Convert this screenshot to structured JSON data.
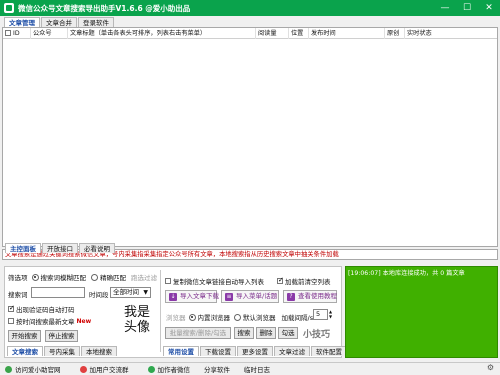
{
  "title": "微信公众号文章搜索导出助手V1.6.6  @爱小助出品",
  "window_controls": {
    "minimize": "—",
    "maximize": "☐",
    "close": "✕"
  },
  "top_tabs": [
    "文章管理",
    "文章合并",
    "登录软件"
  ],
  "columns": [
    "ID",
    "公众号",
    "文章标题（单击各表头可排序，列表右击有菜单）",
    "阅读量",
    "位置",
    "发布时间",
    "原创",
    "实时状态"
  ],
  "info_text": "文章搜索是通过关键词搜索微信文章，号内采集指采集指定公众号所有文章，本地搜索指从历史搜索文章中抽关条件加载",
  "panel_tabs": [
    "主控面板",
    "开放接口",
    "必看说明"
  ],
  "search": {
    "mode_label": "筛选项",
    "mode_fuzzy": "搜索词模糊匹配",
    "mode_exact": "精确匹配",
    "ad_filter": "跑选过滤",
    "keyword_label": "搜索词",
    "time_label": "时间段",
    "time_value": "全部时间",
    "captcha_label": "出现验证码自动打码",
    "latest_label": "按时间搜索最新文章",
    "new_tag": "New",
    "start_button": "开始搜索",
    "stop_button": "停止搜索"
  },
  "qr_text": [
    "我是",
    "头像"
  ],
  "options": {
    "copy_link": "复制微信文章链接自动导入列表",
    "clear_on_load": "加载前清空列表",
    "import_download": "导入文章下载",
    "import_menu": "导入菜单/话题",
    "view_tutorial": "查看使用教程",
    "browser_label": "浏览器",
    "browser_internal": "内置浏览器",
    "browser_default": "默认浏览器",
    "interval_label": "加载间隔/s",
    "interval_value": "5",
    "batch_button": "批量搜索/删除/勾选",
    "search_btn": "搜索",
    "delete_btn": "删除",
    "check_btn": "勾选",
    "tips": "小技巧"
  },
  "left_bottom_tabs": [
    "文章搜索",
    "号内采集",
    "本地搜索"
  ],
  "right_bottom_tabs": [
    "常用设置",
    "下载设置",
    "更多设置",
    "文章过滤",
    "软件配置"
  ],
  "log": {
    "time": "[19:06:07]",
    "text": "本地库连接成功，共 0 篇文章"
  },
  "status": {
    "items": [
      {
        "label": "访问爱小助官网",
        "color": "#3aa34a"
      },
      {
        "label": "加用户交流群",
        "color": "#e04040"
      },
      {
        "label": "加作者微信",
        "color": "#2fa84f"
      },
      {
        "label": "分享软件",
        "color": ""
      },
      {
        "label": "临时日志",
        "color": ""
      }
    ]
  },
  "colors": {
    "titlebar": "#0aa34c",
    "log_bg": "#40b000",
    "info_text": "#c00000"
  }
}
